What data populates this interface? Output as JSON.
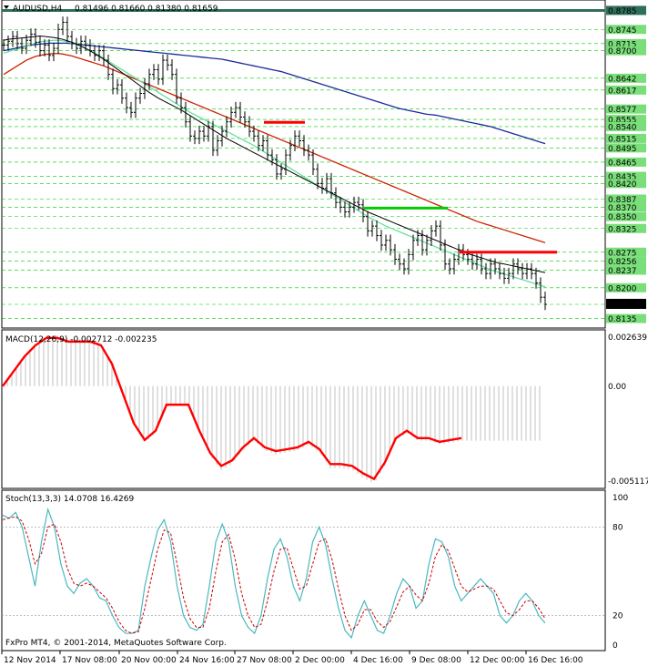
{
  "chart_data": [
    {
      "type": "line",
      "panel": "price",
      "title": "AUDUSD,H4",
      "ohlc_label": "0.81496 0.81660 0.81380 0.81659",
      "ylim": [
        0.8115,
        0.8807
      ],
      "price_levels": [
        "0.8785",
        "0.8745",
        "0.8715",
        "0.8700",
        "0.8642",
        "0.8617",
        "0.8577",
        "0.8555",
        "0.8540",
        "0.8515",
        "0.8495",
        "0.8465",
        "0.8435",
        "0.8420",
        "0.8387",
        "0.8370",
        "0.8350",
        "0.8325",
        "0.8275",
        "0.8256",
        "0.8237",
        "0.8200",
        "0.8169",
        "0.8135"
      ],
      "price_level_marks": [
        0.8785,
        0.8745,
        0.8715,
        0.87,
        0.8642,
        0.8617,
        0.8577,
        0.8555,
        0.854,
        0.8515,
        0.8495,
        0.8465,
        0.8435,
        0.842,
        0.8387,
        0.837,
        0.835,
        0.8325,
        0.8275,
        0.8256,
        0.8237,
        0.82,
        0.8165,
        0.8135
      ],
      "current_price": "0.81659",
      "xlabels": [
        "12 Nov 2014",
        "17 Nov 08:00",
        "20 Nov 00:00",
        "24 Nov 16:00",
        "27 Nov 08:00",
        "2 Dec 00:00",
        "4 Dec 16:00",
        "9 Dec 08:00",
        "12 Dec 00:00",
        "16 Dec 16:00"
      ],
      "x": [
        0,
        5,
        10,
        15,
        20,
        25,
        30,
        35,
        40,
        45,
        50,
        55,
        60,
        65,
        70,
        75,
        80,
        85,
        90,
        95,
        100,
        105,
        110,
        115,
        120,
        125,
        130,
        135,
        140,
        145,
        150,
        155,
        160,
        165,
        170,
        175,
        180,
        185,
        190,
        195,
        200,
        205,
        210,
        215,
        220,
        225,
        230,
        235,
        240,
        245,
        250,
        255,
        260,
        265,
        270,
        275,
        280,
        285,
        290,
        295,
        300,
        305,
        310,
        315,
        320,
        325,
        330,
        335,
        340,
        345,
        350,
        355,
        360,
        365,
        370,
        375,
        380,
        385,
        390,
        395,
        400,
        405,
        410,
        415,
        420,
        425,
        430,
        435,
        440,
        445,
        450,
        455,
        460,
        465,
        470,
        475,
        480,
        485,
        490,
        495,
        500,
        505,
        510,
        515,
        520,
        525,
        530,
        535,
        540,
        545,
        550,
        555,
        560,
        565,
        570,
        575,
        580,
        585,
        590,
        595
      ],
      "close": [
        0.8712,
        0.872,
        0.873,
        0.8715,
        0.8705,
        0.8722,
        0.8735,
        0.8718,
        0.87,
        0.8712,
        0.869,
        0.8705,
        0.8745,
        0.876,
        0.873,
        0.8715,
        0.8705,
        0.872,
        0.8712,
        0.87,
        0.869,
        0.87,
        0.868,
        0.865,
        0.862,
        0.8628,
        0.86,
        0.858,
        0.857,
        0.86,
        0.861,
        0.863,
        0.865,
        0.866,
        0.864,
        0.868,
        0.867,
        0.865,
        0.86,
        0.858,
        0.855,
        0.852,
        0.8515,
        0.853,
        0.852,
        0.854,
        0.849,
        0.851,
        0.853,
        0.855,
        0.857,
        0.858,
        0.856,
        0.855,
        0.853,
        0.852,
        0.85,
        0.851,
        0.848,
        0.847,
        0.844,
        0.845,
        0.848,
        0.85,
        0.852,
        0.851,
        0.849,
        0.848,
        0.845,
        0.842,
        0.841,
        0.843,
        0.84,
        0.838,
        0.837,
        0.836,
        0.837,
        0.838,
        0.8375,
        0.835,
        0.832,
        0.833,
        0.831,
        0.829,
        0.83,
        0.828,
        0.826,
        0.825,
        0.824,
        0.827,
        0.83,
        0.831,
        0.828,
        0.83,
        0.832,
        0.833,
        0.829,
        0.825,
        0.824,
        0.826,
        0.828,
        0.827,
        0.826,
        0.825,
        0.826,
        0.824,
        0.823,
        0.825,
        0.824,
        0.823,
        0.822,
        0.823,
        0.825,
        0.824,
        0.823,
        0.824,
        0.823,
        0.821,
        0.818,
        0.8165
      ],
      "ma_green": [
        0.8695,
        0.8698,
        0.8701,
        0.8703,
        0.8706,
        0.871,
        0.8713,
        0.8716,
        0.8719,
        0.872,
        0.8721,
        0.8722,
        0.8722,
        0.8721,
        0.8719,
        0.8716,
        0.8713,
        0.8709,
        0.8705,
        0.87,
        0.8695,
        0.869,
        0.8684,
        0.8678,
        0.8672,
        0.8666,
        0.866,
        0.8654,
        0.8648,
        0.8642,
        0.8636,
        0.863,
        0.8624,
        0.8618,
        0.8612,
        0.8606,
        0.86,
        0.8594,
        0.8588,
        0.8582,
        0.8576,
        0.857,
        0.8565,
        0.856,
        0.8555,
        0.855,
        0.8545,
        0.854,
        0.8535,
        0.853,
        0.8525,
        0.852,
        0.8515,
        0.851,
        0.8505,
        0.85,
        0.8494,
        0.8488,
        0.8482,
        0.8476,
        0.847,
        0.8464,
        0.8458,
        0.8452,
        0.8446,
        0.844,
        0.8434,
        0.8428,
        0.8422,
        0.8416,
        0.841,
        0.8404,
        0.8398,
        0.8392,
        0.8386,
        0.838,
        0.8374,
        0.8368,
        0.8362,
        0.8356,
        0.835,
        0.8345,
        0.834,
        0.8335,
        0.833,
        0.8326,
        0.8322,
        0.8318,
        0.8314,
        0.831,
        0.8306,
        0.8302,
        0.8298,
        0.8294,
        0.829,
        0.8286,
        0.8282,
        0.8278,
        0.8274,
        0.827,
        0.8266,
        0.8262,
        0.8258,
        0.8254,
        0.825,
        0.8246,
        0.8242,
        0.8238,
        0.8235,
        0.8232,
        0.8229,
        0.8226,
        0.8223,
        0.822,
        0.8217,
        0.8214,
        0.8211,
        0.8208,
        0.8205,
        0.8202
      ],
      "ma_black": [
        0.8722,
        0.8724,
        0.8725,
        0.8726,
        0.8727,
        0.8728,
        0.8729,
        0.873,
        0.8731,
        0.873,
        0.8729,
        0.8728,
        0.8726,
        0.8724,
        0.8721,
        0.8718,
        0.8714,
        0.871,
        0.8705,
        0.87,
        0.8694,
        0.8688,
        0.8682,
        0.8675,
        0.8668,
        0.8661,
        0.8654,
        0.8647,
        0.864,
        0.8633,
        0.8626,
        0.8619,
        0.8612,
        0.8606,
        0.86,
        0.8595,
        0.859,
        0.8585,
        0.858,
        0.8575,
        0.8569,
        0.8563,
        0.8557,
        0.8551,
        0.8545,
        0.8539,
        0.8533,
        0.8527,
        0.8521,
        0.8515,
        0.851,
        0.8505,
        0.85,
        0.8495,
        0.849,
        0.8485,
        0.848,
        0.8475,
        0.847,
        0.8465,
        0.846,
        0.8455,
        0.845,
        0.8445,
        0.844,
        0.8435,
        0.843,
        0.8425,
        0.842,
        0.8415,
        0.841,
        0.8405,
        0.84,
        0.8395,
        0.839,
        0.8385,
        0.838,
        0.8375,
        0.837,
        0.8365,
        0.836,
        0.8356,
        0.8352,
        0.8348,
        0.8344,
        0.834,
        0.8336,
        0.8332,
        0.8328,
        0.8324,
        0.832,
        0.8316,
        0.8312,
        0.8308,
        0.8304,
        0.83,
        0.8296,
        0.8292,
        0.8288,
        0.8284,
        0.828,
        0.8276,
        0.8272,
        0.8269,
        0.8266,
        0.8263,
        0.826,
        0.8257,
        0.8254,
        0.8252,
        0.825,
        0.8248,
        0.8246,
        0.8244,
        0.8242,
        0.824,
        0.8238,
        0.8236,
        0.8234,
        0.8232
      ],
      "ma_red": [
        0.865,
        0.8656,
        0.8662,
        0.8668,
        0.8674,
        0.868,
        0.8684,
        0.8688,
        0.869,
        0.8692,
        0.8693,
        0.8694,
        0.8694,
        0.8693,
        0.8691,
        0.8689,
        0.8686,
        0.8683,
        0.868,
        0.8677,
        0.8674,
        0.8671,
        0.8668,
        0.8664,
        0.866,
        0.8656,
        0.8652,
        0.8648,
        0.8644,
        0.864,
        0.8636,
        0.8632,
        0.8628,
        0.8624,
        0.862,
        0.8616,
        0.8612,
        0.8608,
        0.8604,
        0.86,
        0.8596,
        0.8592,
        0.8588,
        0.8584,
        0.858,
        0.8576,
        0.8572,
        0.8568,
        0.8564,
        0.856,
        0.8556,
        0.8552,
        0.8548,
        0.8544,
        0.854,
        0.8536,
        0.8532,
        0.8528,
        0.8524,
        0.852,
        0.8516,
        0.8512,
        0.8508,
        0.8504,
        0.85,
        0.8496,
        0.8492,
        0.8488,
        0.8484,
        0.848,
        0.8476,
        0.8472,
        0.8468,
        0.8464,
        0.846,
        0.8456,
        0.8452,
        0.8448,
        0.8444,
        0.844,
        0.8436,
        0.8432,
        0.8428,
        0.8424,
        0.842,
        0.8416,
        0.8412,
        0.8408,
        0.8404,
        0.84,
        0.8396,
        0.8392,
        0.8388,
        0.8384,
        0.838,
        0.8376,
        0.8372,
        0.8368,
        0.8364,
        0.836,
        0.8356,
        0.8352,
        0.8348,
        0.8344,
        0.834,
        0.8337,
        0.8334,
        0.8331,
        0.8328,
        0.8325,
        0.8322,
        0.8319,
        0.8316,
        0.8313,
        0.831,
        0.8307,
        0.8304,
        0.8301,
        0.8298,
        0.8295
      ],
      "ma_blue": [
        0.87,
        0.8702,
        0.8704,
        0.8706,
        0.8708,
        0.871,
        0.8712,
        0.8713,
        0.8714,
        0.8715,
        0.8716,
        0.8716,
        0.8716,
        0.8716,
        0.8716,
        0.8715,
        0.8714,
        0.8713,
        0.8712,
        0.8711,
        0.871,
        0.8709,
        0.8708,
        0.8707,
        0.8706,
        0.8705,
        0.8704,
        0.8703,
        0.8702,
        0.8701,
        0.87,
        0.8699,
        0.8698,
        0.8697,
        0.8696,
        0.8695,
        0.8694,
        0.8693,
        0.8692,
        0.8691,
        0.869,
        0.8689,
        0.8688,
        0.8687,
        0.8686,
        0.8685,
        0.8684,
        0.8683,
        0.8682,
        0.868,
        0.8678,
        0.8676,
        0.8674,
        0.8672,
        0.867,
        0.8668,
        0.8666,
        0.8664,
        0.8662,
        0.866,
        0.8658,
        0.8656,
        0.8653,
        0.865,
        0.8647,
        0.8644,
        0.8641,
        0.8638,
        0.8635,
        0.8632,
        0.8629,
        0.8626,
        0.8623,
        0.862,
        0.8617,
        0.8614,
        0.8611,
        0.8608,
        0.8605,
        0.8602,
        0.8599,
        0.8596,
        0.8593,
        0.859,
        0.8587,
        0.8584,
        0.8581,
        0.8578,
        0.8576,
        0.8574,
        0.8572,
        0.857,
        0.8568,
        0.8566,
        0.8565,
        0.8564,
        0.8562,
        0.856,
        0.8558,
        0.8556,
        0.8554,
        0.8552,
        0.855,
        0.8548,
        0.8546,
        0.8544,
        0.8542,
        0.854,
        0.8537,
        0.8534,
        0.8531,
        0.8528,
        0.8525,
        0.8522,
        0.8519,
        0.8516,
        0.8513,
        0.851,
        0.8507,
        0.8504
      ],
      "hlines": [
        {
          "name": "red-resistance-1",
          "x0": 290,
          "x1": 335,
          "y": 0.8549,
          "color": "#ff0000"
        },
        {
          "name": "green-line",
          "x0": 400,
          "x1": 492,
          "y": 0.8368,
          "color": "#00cc00"
        },
        {
          "name": "red-resistance-2",
          "x0": 505,
          "x1": 612,
          "y": 0.8275,
          "color": "#ff0000"
        }
      ]
    },
    {
      "type": "bar",
      "panel": "macd",
      "title": "MACD(12,26,9) -0.002712 -0.002235",
      "ylim": [
        -0.005117,
        0.002639
      ],
      "tick_labels": [
        "0.002639",
        "0.00",
        "-0.005117"
      ],
      "tick_values": [
        0.002639,
        0.0,
        -0.005117
      ],
      "signal": [
        0.0,
        0.0008,
        0.0016,
        0.0022,
        0.0026,
        0.0026,
        0.0024,
        0.0024,
        0.0024,
        0.0022,
        0.0012,
        -0.0004,
        -0.002,
        -0.0029,
        -0.0024,
        -0.001,
        -0.001,
        -0.0024,
        -0.0036,
        -0.0043,
        -0.004,
        -0.0033,
        -0.0028,
        -0.0033,
        -0.0035,
        -0.0034,
        -0.0033,
        -0.003,
        -0.0034,
        -0.0042,
        -0.0042,
        -0.0043,
        -0.0047,
        -0.005,
        -0.0041,
        -0.0028,
        -0.0024,
        -0.0028,
        -0.0028,
        -0.003,
        -0.0029,
        -0.0028
      ],
      "signal_x": [
        3,
        15,
        27,
        39,
        51,
        63,
        75,
        87,
        99,
        111,
        123,
        135,
        147,
        159,
        171,
        183,
        207,
        219,
        231,
        243,
        255,
        267,
        279,
        291,
        303,
        315,
        327,
        339,
        351,
        363,
        375,
        387,
        399,
        411,
        423,
        435,
        447,
        459,
        471,
        483,
        495,
        507,
        519,
        531,
        543,
        555,
        567,
        579,
        591,
        603
      ],
      "histogram_x_start": 3,
      "histogram_step": 5
    },
    {
      "type": "line",
      "panel": "stochastic",
      "title": "Stoch(13,3,3) 14.0708 16.4269",
      "ylim": [
        0,
        100
      ],
      "tick_labels": [
        "100",
        "80",
        "20",
        "0"
      ],
      "tick_values": [
        100,
        80,
        20,
        0
      ],
      "main": [
        88,
        86,
        90,
        80,
        60,
        40,
        70,
        92,
        80,
        55,
        40,
        35,
        42,
        45,
        40,
        32,
        30,
        20,
        12,
        8,
        8,
        10,
        40,
        60,
        78,
        85,
        70,
        40,
        20,
        12,
        10,
        14,
        40,
        70,
        82,
        70,
        40,
        20,
        12,
        8,
        20,
        45,
        65,
        72,
        60,
        40,
        30,
        45,
        70,
        80,
        68,
        45,
        25,
        10,
        5,
        20,
        30,
        20,
        10,
        8,
        20,
        35,
        45,
        40,
        25,
        30,
        55,
        72,
        70,
        60,
        40,
        30,
        35,
        40,
        45,
        40,
        35,
        20,
        15,
        20,
        30,
        35,
        30,
        20,
        15
      ],
      "signal": [
        85,
        86,
        87,
        84,
        72,
        55,
        62,
        80,
        82,
        70,
        52,
        42,
        40,
        42,
        40,
        36,
        32,
        25,
        16,
        10,
        8,
        9,
        25,
        45,
        65,
        78,
        76,
        55,
        32,
        18,
        12,
        12,
        25,
        50,
        70,
        75,
        58,
        35,
        20,
        12,
        14,
        30,
        50,
        65,
        66,
        52,
        38,
        40,
        55,
        70,
        72,
        58,
        38,
        20,
        10,
        14,
        24,
        24,
        16,
        12,
        16,
        26,
        36,
        40,
        34,
        30,
        42,
        60,
        68,
        64,
        52,
        40,
        36,
        38,
        40,
        40,
        38,
        30,
        22,
        20,
        24,
        30,
        30,
        25,
        18
      ]
    }
  ],
  "footer_text": "FxPro MT4, © 2001-2014, MetaQuotes Software Corp.",
  "colors": {
    "grid_green": "#00cc00",
    "ma_black": "#000000",
    "ma_green": "#66e0a0",
    "ma_red": "#cc2200",
    "ma_blue": "#1a2a9a",
    "macd_line": "#ff0000",
    "macd_hist": "#c0c0c0",
    "stoch_main": "#4ab8c0",
    "stoch_signal": "#cc0000",
    "top_band": "#2e6e5a"
  }
}
